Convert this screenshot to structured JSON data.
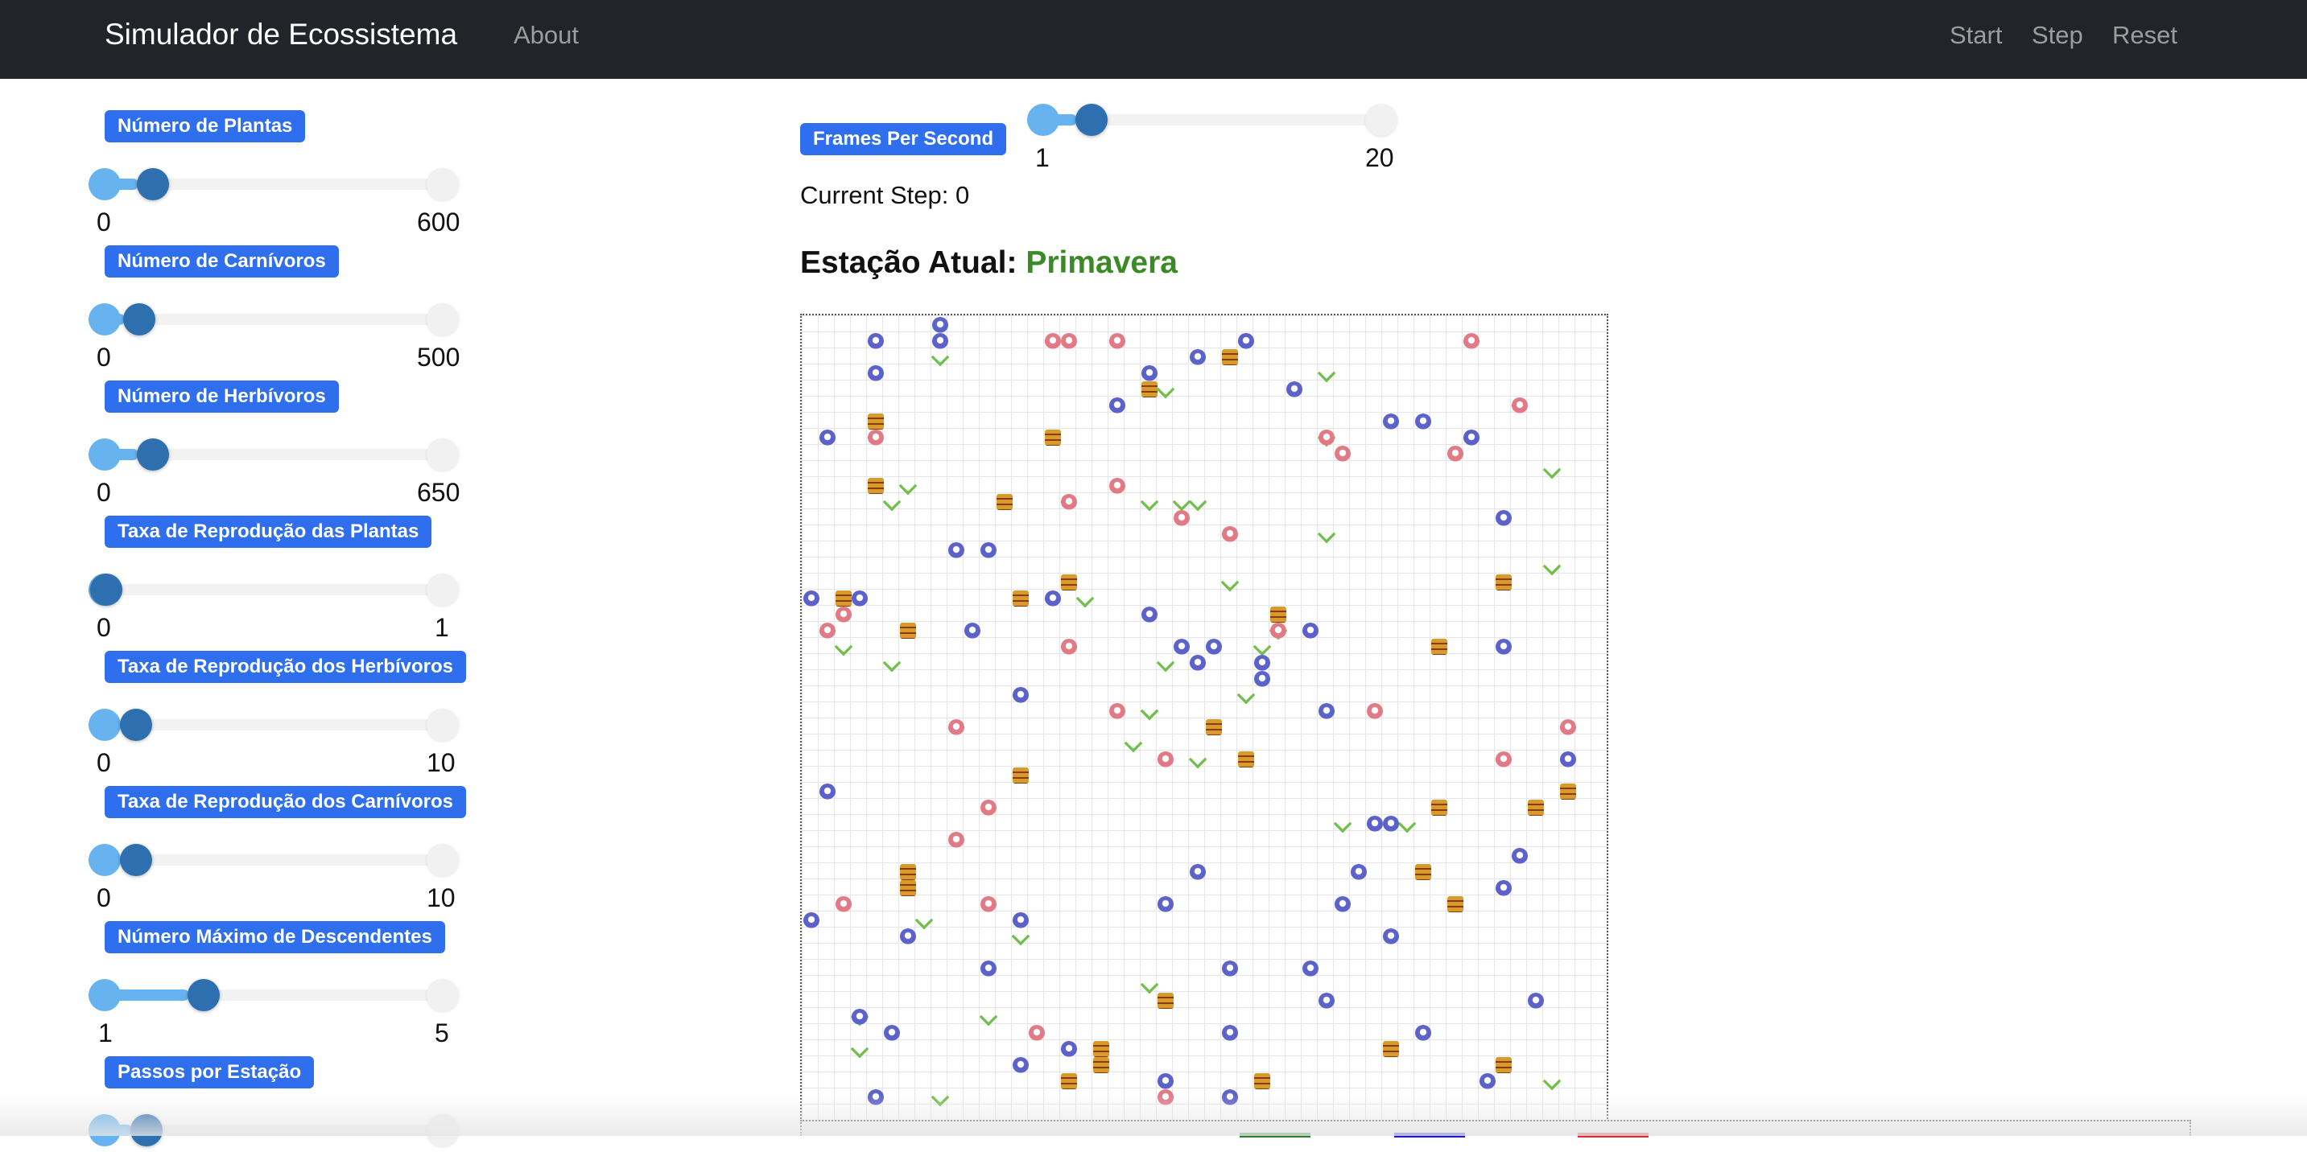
{
  "nav": {
    "brand": "Simulador de Ecossistema",
    "about": "About",
    "start": "Start",
    "step": "Step",
    "reset": "Reset"
  },
  "controls": [
    {
      "label": "Número de Plantas",
      "min": "0",
      "max": "600",
      "level": 0.1
    },
    {
      "label": "Número de Carnívoros",
      "min": "0",
      "max": "500",
      "level": 0.06
    },
    {
      "label": "Número de Herbívoros",
      "min": "0",
      "max": "650",
      "level": 0.1
    },
    {
      "label": "Taxa de Reprodução das Plantas",
      "min": "0",
      "max": "1",
      "level": 0.0
    },
    {
      "label": "Taxa de Reprodução dos Herbívoros",
      "min": "0",
      "max": "10",
      "level": 0.05
    },
    {
      "label": "Taxa de Reprodução dos Carnívoros",
      "min": "0",
      "max": "10",
      "level": 0.05
    },
    {
      "label": "Número Máximo de Descendentes",
      "min": "1",
      "max": "5",
      "level": 0.25
    },
    {
      "label": "Passos por Estação",
      "min": "",
      "max": "",
      "level": 0.08
    }
  ],
  "fps": {
    "label": "Frames Per Second",
    "min": "1",
    "max": "20",
    "level": 0.1
  },
  "current_step": "Current Step: 0",
  "season": {
    "label": "Estação Atual:",
    "value": "Primavera",
    "color": "#3a8a25"
  },
  "colors": {
    "navbar": "#212529",
    "badge": "#2f6fed",
    "slider_fill": "#66b3f0",
    "slider_handle": "#2e6fb0",
    "plant": "#6fbf4a",
    "herbivore": "#5b62c9",
    "carnivore": "#e27a86",
    "food": "#d79a2b",
    "legend_green": "#2e7d32",
    "legend_blue": "#1c1cc2",
    "legend_red": "#d32f2f"
  }
}
